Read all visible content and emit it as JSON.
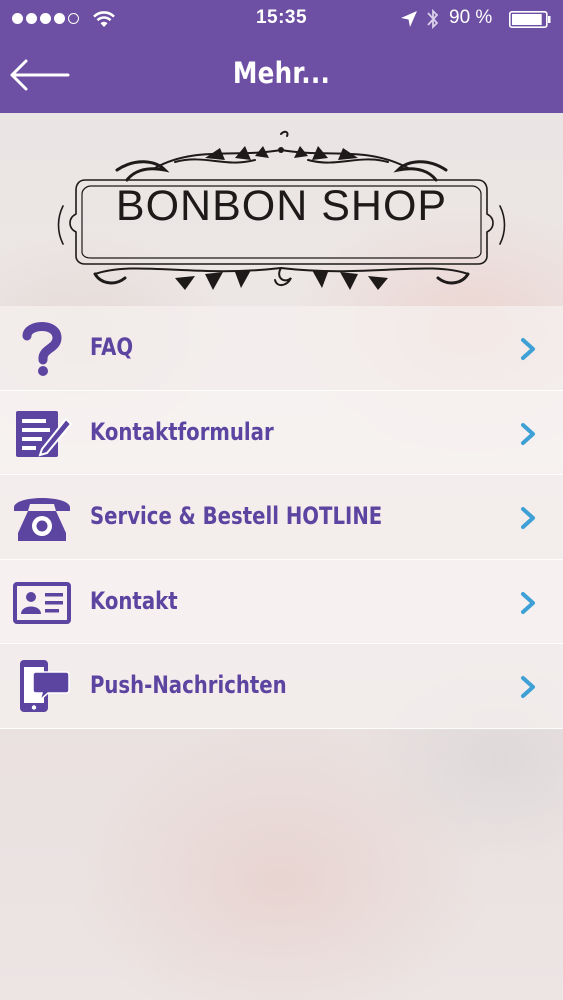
{
  "status_bar": {
    "time": "15:35",
    "battery_percent": "90 %",
    "battery_level": 0.9,
    "signal_dots_filled": 4,
    "signal_dots_total": 5
  },
  "nav": {
    "title": "Mehr...",
    "back_icon": "arrow-left-icon"
  },
  "logo": {
    "text": "BONBON SHOP"
  },
  "colors": {
    "header_bg": "#6d50a3",
    "label": "#5b45a0",
    "icon": "#5b45a0",
    "chevron": "#3fa0d6"
  },
  "menu": {
    "items": [
      {
        "label": "FAQ",
        "icon": "question-mark-icon"
      },
      {
        "label": "Kontaktformular",
        "icon": "form-pencil-icon"
      },
      {
        "label": "Service & Bestell HOTLINE",
        "icon": "telephone-icon"
      },
      {
        "label": "Kontakt",
        "icon": "id-card-icon"
      },
      {
        "label": "Push-Nachrichten",
        "icon": "phone-message-icon"
      }
    ]
  }
}
